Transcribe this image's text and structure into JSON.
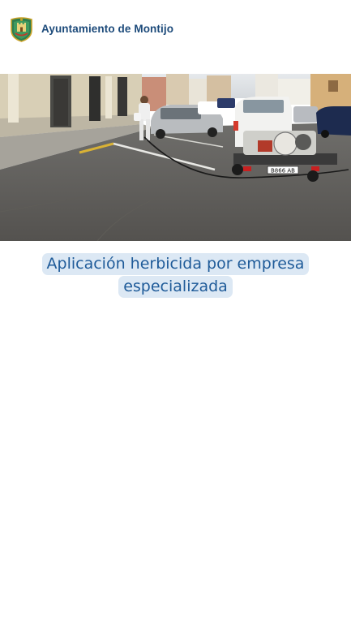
{
  "header": {
    "title": "Ayuntamiento de Montijo",
    "logo_icon": "coat-of-arms-icon"
  },
  "post": {
    "image_alt": "Operario aplicando herbicida en la calle junto a vehículo con remolque",
    "caption_line1": "Aplicación herbicida por empresa",
    "caption_line2": "especializada",
    "caption_color": "#1f5b99",
    "caption_bg": "#dce8f4"
  },
  "colors": {
    "brand": "#1c4a7a",
    "background": "#ffffff"
  }
}
